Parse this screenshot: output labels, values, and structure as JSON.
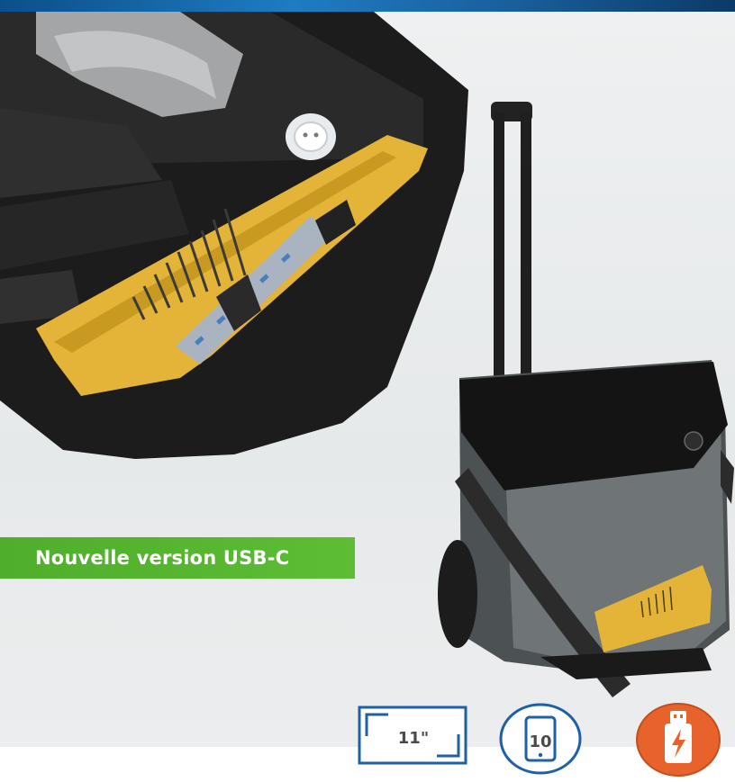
{
  "banner": {
    "text": "Nouvelle version USB-C"
  },
  "badges": {
    "screen_size": "11\"",
    "tablet_count": "10",
    "usb_icon": "usb-charging-icon"
  },
  "colors": {
    "accent_green": "#5dbd34",
    "badge_blue": "#1f5fa6",
    "usb_orange": "#e8622c",
    "charger_yellow": "#e3b437",
    "top_bar_blue": "#1e7cc2"
  }
}
